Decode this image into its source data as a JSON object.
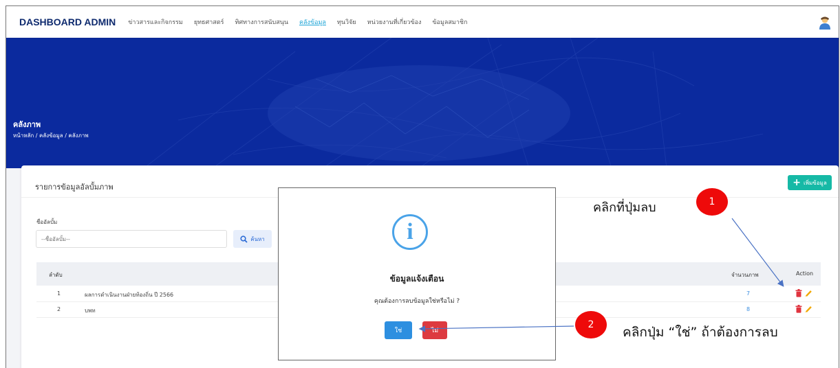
{
  "topnav": {
    "brand": "DASHBOARD ADMIN",
    "items": [
      {
        "label": "ข่าวสารและกิจกรรม"
      },
      {
        "label": "ยุทธศาสตร์"
      },
      {
        "label": "ทิศทางการสนับสนุน"
      },
      {
        "label": "คลังข้อมูล",
        "active": true
      },
      {
        "label": "ทุนวิจัย"
      },
      {
        "label": "หน่วยงานที่เกี่ยวข้อง"
      },
      {
        "label": "ข้อมูลสมาชิก"
      }
    ]
  },
  "hero": {
    "title": "คลังภาพ",
    "breadcrumb": "หน้าหลัก / คลังข้อมูล / คลังภาพ",
    "bg_color": "#0b2a9e"
  },
  "card": {
    "title": "รายการข้อมูลอัลบั้มภาพ",
    "add_button": "เพิ่มข้อมูล",
    "search_label": "ชื่ออัลบั้ม",
    "search_placeholder": "--ชื่ออัลบั้ม--",
    "search_button": "ค้นหา"
  },
  "table": {
    "headers": {
      "index": "ลำดับ",
      "count": "จำนวนภาพ",
      "action": "Action"
    },
    "rows": [
      {
        "index": "1",
        "name": "ผลการดำเนินงานฝ่ายท้องถิ่น ปี 2566",
        "count": "7"
      },
      {
        "index": "2",
        "name": "บพท",
        "count": "8"
      }
    ]
  },
  "dialog": {
    "icon": "info-icon",
    "title": "ข้อมูลแจ้งเตือน",
    "message": "คุณต้องการลบข้อมูลใช่หรือไม่ ?",
    "yes_label": "ใช่",
    "no_label": "ไม่"
  },
  "annotations": {
    "step1_text": "คลิกที่ปุ่มลบ",
    "step1_badge": "1",
    "step2_text": "คลิกปุ่ม “ใช่” ถ้าต้องการลบ",
    "step2_badge": "2",
    "badge_color": "#ee0a0a",
    "arrow_color": "#4a72c4"
  }
}
